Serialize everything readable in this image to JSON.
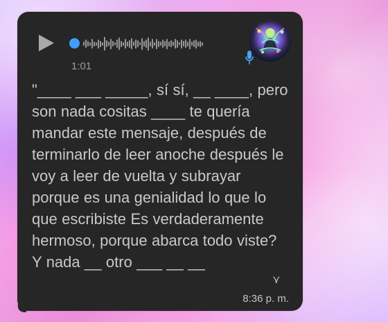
{
  "message": {
    "duration": "1:01",
    "transcript": "\"____ ___ _____, sí sí, __ ____, pero son nada cositas ____ te quería mandar este mensaje, después de terminarlo de leer anoche después le voy a leer de vuelta y subrayar porque es una genialidad lo que lo que escribiste Es verdaderamente hermoso, porque abarca todo viste? Y nada __ otro ___ __ __",
    "time": "8:36 p. m.",
    "more_glyph": "⋎",
    "colors": {
      "bubble": "#262626",
      "playhead": "#3f9fff",
      "waveform": "#979797",
      "text": "#c9c9c9"
    },
    "icons": {
      "play": "play-icon",
      "avatar": "avatar",
      "mic": "microphone-icon",
      "more": "chevron-down-icon"
    }
  }
}
